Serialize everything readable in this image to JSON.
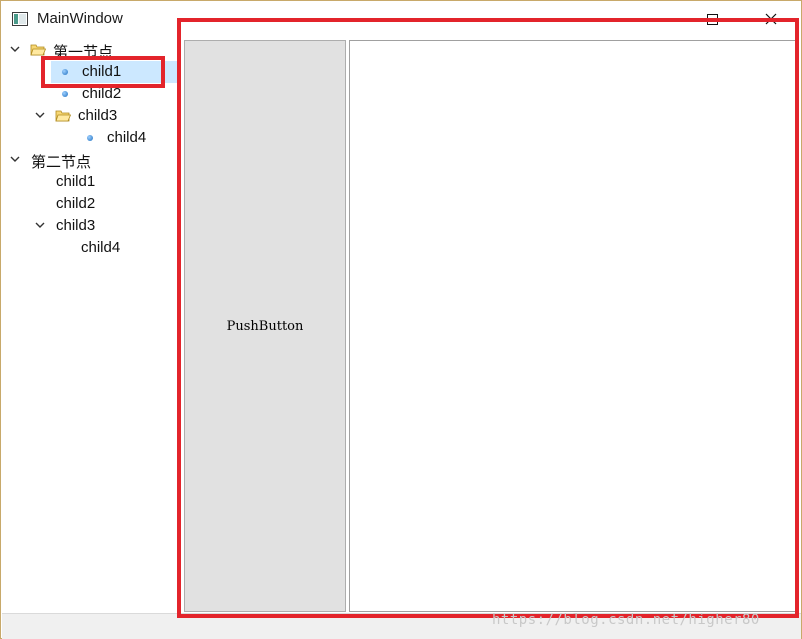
{
  "window": {
    "title": "MainWindow"
  },
  "tree": {
    "root1": {
      "label": "第一节点",
      "children": [
        "child1",
        "child2",
        "child3"
      ],
      "grandchild": "child4"
    },
    "root2": {
      "label": "第二节点",
      "children": [
        "child1",
        "child2",
        "child3"
      ],
      "grandchild": "child4"
    }
  },
  "button": {
    "label": "PushButton"
  },
  "watermark": "https://blog.csdn.net/higher80",
  "colors": {
    "highlight_border": "#e3242b",
    "selection": "#cce8ff"
  }
}
